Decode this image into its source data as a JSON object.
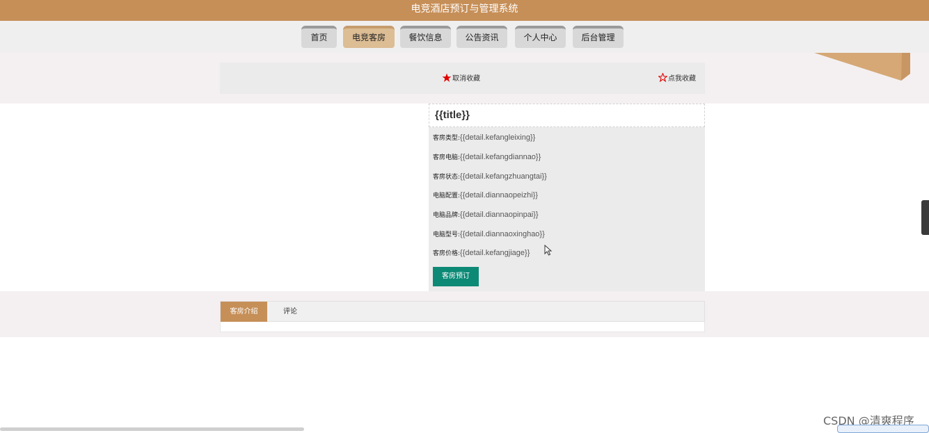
{
  "header": {
    "title": "电竞酒店预订与管理系统"
  },
  "nav": {
    "items": [
      {
        "label": "首页"
      },
      {
        "label": "电竞客房"
      },
      {
        "label": "餐饮信息"
      },
      {
        "label": "公告资讯"
      },
      {
        "label": "个人中心"
      },
      {
        "label": "后台管理"
      }
    ],
    "active_index": 1
  },
  "favorites": {
    "cancel_label": "取消收藏",
    "add_label": "点我收藏"
  },
  "detail": {
    "title": "{{title}}",
    "fields": [
      {
        "label": "客房类型:",
        "value": "{{detail.kefangleixing}}"
      },
      {
        "label": "客房电脑:",
        "value": "{{detail.kefangdiannao}}"
      },
      {
        "label": "客房状态:",
        "value": "{{detail.kefangzhuangtai}}"
      },
      {
        "label": "电脑配置:",
        "value": "{{detail.diannaopeizhi}}"
      },
      {
        "label": "电脑品牌:",
        "value": "{{detail.diannaopinpai}}"
      },
      {
        "label": "电脑型号:",
        "value": "{{detail.diannaoxinghao}}"
      },
      {
        "label": "客房价格:",
        "value": "{{detail.kefangjiage}}"
      }
    ],
    "book_label": "客房预订"
  },
  "tabs": [
    {
      "label": "客房介绍"
    },
    {
      "label": "评论"
    }
  ],
  "watermark": "CSDN @清爽程序",
  "colors": {
    "brand": "#c68f58",
    "nav_active": "#dcbd94",
    "button": "#0d8a76",
    "star": "#e00000"
  }
}
